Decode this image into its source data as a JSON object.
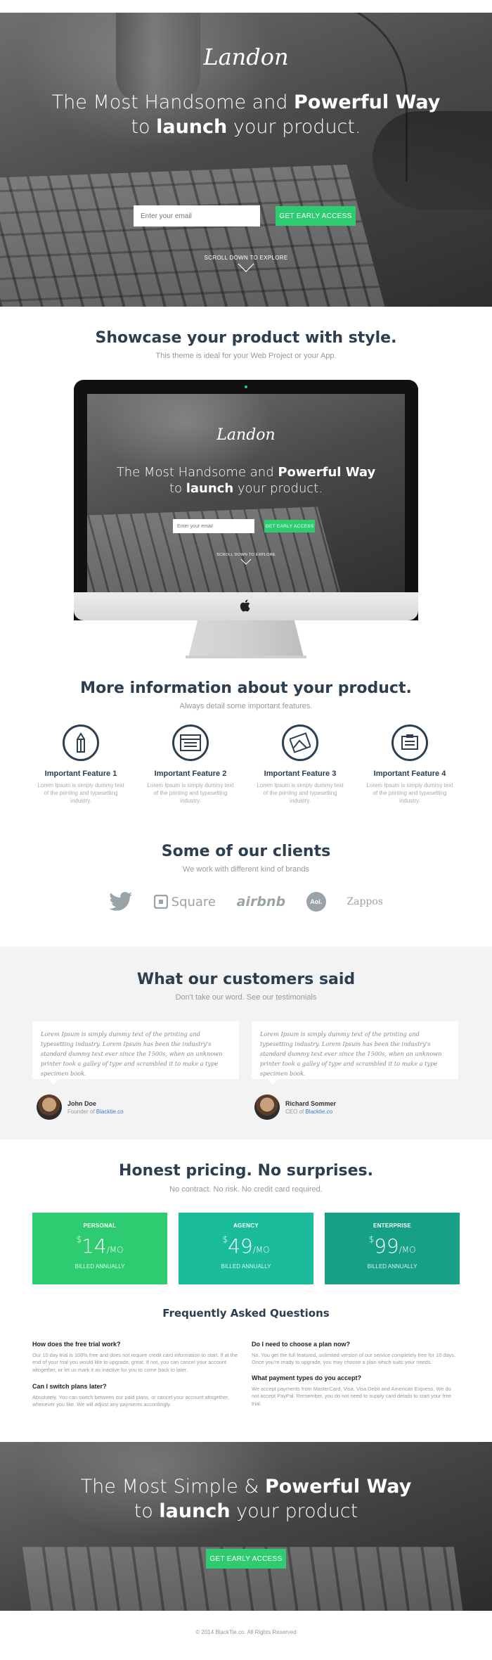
{
  "hero": {
    "logo": "Landon",
    "title_line1_prefix": "The Most Handsome and ",
    "title_line1_bold": "Powerful Way",
    "title_line2_prefix": "to ",
    "title_line2_bold": "launch",
    "title_line2_suffix": " your product.",
    "email_placeholder": "Enter your email",
    "cta_label": "GET EARLY ACCESS",
    "scroll_label": "SCROLL DOWN TO EXPLORE"
  },
  "showcase": {
    "title": "Showcase your product with style.",
    "subtitle": "This theme is ideal for your Web Project or your App.",
    "screen": {
      "logo": "Landon",
      "title_line1_prefix": "The Most Handsome and ",
      "title_line1_bold": "Powerful Way",
      "title_line2_prefix": "to ",
      "title_line2_bold": "launch",
      "title_line2_suffix": " your product.",
      "email_placeholder": "Enter your email",
      "cta_label": "GET EARLY ACCESS",
      "scroll_label": "SCROLL DOWN TO EXPLORE"
    }
  },
  "features": {
    "title": "More information about your product.",
    "subtitle": "Always detail some important features.",
    "items": [
      {
        "icon": "pencil-icon",
        "title": "Important Feature 1",
        "text": "Lorem Ipsum is simply dummy text of the printing and typesetting industry."
      },
      {
        "icon": "browser-window-icon",
        "title": "Important Feature 2",
        "text": "Lorem Ipsum is simply dummy text of the printing and typesetting industry."
      },
      {
        "icon": "image-icon",
        "title": "Important Feature 3",
        "text": "Lorem Ipsum is simply dummy text of the printing and typesetting industry."
      },
      {
        "icon": "clipboard-icon",
        "title": "Important Feature 4",
        "text": "Lorem Ipsum is simply dummy text of the printing and typesetting industry."
      }
    ]
  },
  "clients": {
    "title": "Some of our clients",
    "subtitle": "We work with different kind of brands",
    "logos": [
      {
        "icon": "twitter-bird-icon",
        "label": ""
      },
      {
        "icon": "square-logo-icon",
        "label": "Square"
      },
      {
        "icon": "airbnb-logo",
        "label": "airbnb"
      },
      {
        "icon": "aol-logo-icon",
        "label": "Aol."
      },
      {
        "icon": "zappos-logo",
        "label": "Zappos"
      }
    ]
  },
  "testimonials": {
    "title": "What our customers said",
    "subtitle": "Don't take our word. See our testimonials",
    "items": [
      {
        "quote": "Lorem Ipsum is simply dummy text of the printing and typesetting industry. Lorem Ipsum has been the industry's standard dummy text ever since the 1500s, when an unknown printer took a galley of type and scrambled it to make a type specimen book.",
        "name": "John Doe",
        "role": "Founder of ",
        "company": "Blacktie.co"
      },
      {
        "quote": "Lorem Ipsum is simply dummy text of the printing and typesetting industry. Lorem Ipsum has been the industry's standard dummy text ever since the 1500s, when an unknown printer took a galley of type and scrambled it to make a type specimen book.",
        "name": "Richard Sommer",
        "role": "CEO of ",
        "company": "Blacktie.co"
      }
    ]
  },
  "pricing": {
    "title": "Honest pricing. No surprises.",
    "subtitle": "No contract. No risk. No credit card required.",
    "plans": [
      {
        "name": "PERSONAL",
        "currency": "$",
        "amount": "14",
        "period": "/MO",
        "billing": "BILLED ANNUALLY",
        "color": "#2ecc71"
      },
      {
        "name": "AGENCY",
        "currency": "$",
        "amount": "49",
        "period": "/MO",
        "billing": "BILLED ANNUALLY",
        "color": "#1abc9c"
      },
      {
        "name": "ENTERPRISE",
        "currency": "$",
        "amount": "99",
        "period": "/MO",
        "billing": "BILLED ANNUALLY",
        "color": "#16a085"
      }
    ]
  },
  "faq": {
    "title": "Frequently Asked Questions",
    "items": [
      {
        "q": "How does the free trial work?",
        "a": "Our 10 day trial is 100% free and does not require credit card information to start. If at the end of your trial you would like to upgrade, great. If not, you can cancel your account altogether, or let us mark it as inactive for you to come back to later."
      },
      {
        "q": "Do I need to choose a plan now?",
        "a": "No. You get the full featured, unlimited version of our service completely free for 10 days. Once you're ready to upgrade, you may choose a plan which suits your needs."
      },
      {
        "q": "Can I switch plans later?",
        "a": "Absolutely. You can switch between our paid plans, or cancel your account altogether, whenever you like. We will adjust any payments accordingly."
      },
      {
        "q": "What payment types do you accept?",
        "a": "We accept payments from MasterCard, Visa, Visa Debit and American Express. We do not accept PayPal. Remember, you do not need to supply card details to start your free trial."
      }
    ]
  },
  "cta": {
    "line1_prefix": "The Most Simple & ",
    "line1_bold": "Powerful Way",
    "line2_prefix": "to ",
    "line2_bold": "launch",
    "line2_suffix": " your product",
    "button_label": "GET EARLY ACCESS"
  },
  "footer": {
    "text": "© 2014 BlackTie.co. All Rights Reserved"
  },
  "colors": {
    "accent": "#2ecc71",
    "heading": "#2c3e50"
  }
}
